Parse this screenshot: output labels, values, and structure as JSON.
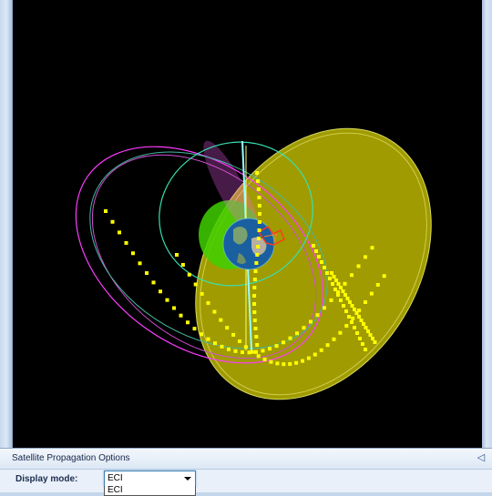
{
  "panel": {
    "title": "Satellite Propagation Options",
    "pin_icon": "pin-icon"
  },
  "display_mode": {
    "label": "Display mode:",
    "selected": "ECI",
    "options": [
      "ECI"
    ]
  },
  "colors": {
    "background": "#000000",
    "coverage_cone": "#b6b000",
    "ground_track": "#ffff00",
    "orbit_magenta": "#ff3cff",
    "orbit_cyan": "#38e0b0",
    "earth_ocean": "#1a5fa0"
  }
}
